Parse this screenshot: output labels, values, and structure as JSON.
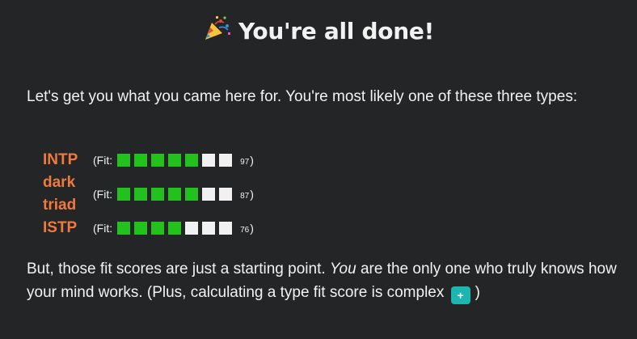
{
  "header": {
    "title": "You're all done!",
    "icon": "party-popper-icon"
  },
  "intro": {
    "text": "Let's get you what you came here for. You're most likely one of these three types:"
  },
  "types": [
    {
      "name": "INTP",
      "fit_prefix": "(Fit:",
      "fit_filled": 5,
      "fit_total": 7,
      "score": "97",
      "fit_suffix": ")"
    },
    {
      "name": "dark triad",
      "fit_prefix": "(Fit:",
      "fit_filled": 5,
      "fit_total": 7,
      "score": "87",
      "fit_suffix": ")"
    },
    {
      "name": "ISTP",
      "fit_prefix": "(Fit:",
      "fit_filled": 4,
      "fit_total": 7,
      "score": "76",
      "fit_suffix": ")"
    }
  ],
  "outro": {
    "part1": "But, those fit scores are just a starting point. ",
    "emphasis": "You",
    "part2": " are the only one who truly knows how your mind works. (Plus, calculating a type fit score is complex ",
    "expand_label": "+",
    "part3": ")"
  },
  "colors": {
    "background": "#232526",
    "type_name": "#f07a3e",
    "fit_filled": "#23c11d",
    "fit_empty": "#f1f1f1",
    "expand_button": "#1db5b0"
  }
}
